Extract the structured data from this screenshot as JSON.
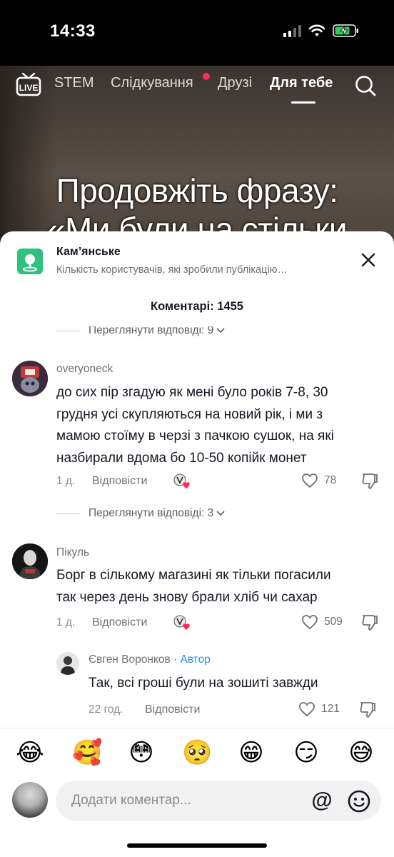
{
  "status_bar": {
    "time": "14:33"
  },
  "nav": {
    "tabs": [
      "STEM",
      "Слідкування",
      "Друзі",
      "Для тебе"
    ],
    "active_tab": "Для тебе",
    "live_label": "LIVE"
  },
  "video": {
    "caption_line1": "Продовжіть фразу:",
    "caption_line2": "«Ми були на стільки"
  },
  "sheet": {
    "location_title": "Кам’янське",
    "location_subtitle": "Кількість користувачів, які зробили публікацію…",
    "comments_count": "Коментарі: 1455",
    "top_replies": "Переглянути відповіді: 9",
    "comments": [
      {
        "username": "overyoneck",
        "text_lines": [
          "до сих пір згадую як мені було років 7-8, 30",
          "грудня усі скупляються на новий рік, і ми з",
          "мамою стоїму в черзі з пачкою сушок, на які",
          "назбирали вдома бо 10-50 копійк монет"
        ],
        "time": "1 д.",
        "reply_label": "Відповісти",
        "likes": "78",
        "replies": "Переглянути відповіді: 3"
      },
      {
        "username": "Пікуль",
        "text_lines": [
          "Борг в сількому магазині як тільки погасили",
          "так через день знову брали хліб чи сахар"
        ],
        "time": "1 д.",
        "reply_label": "Відповісти",
        "likes": "509"
      }
    ],
    "reply": {
      "username": "Євген Воронков",
      "separator": " · ",
      "author_tag": "Автор",
      "text": "Так, всі гроші були на зошиті завжди",
      "time": "22 год.",
      "reply_label": "Відповісти",
      "likes": "121"
    },
    "emojis": [
      "😂",
      "🥰",
      "😳",
      "🥺",
      "😁",
      "😏",
      "😅"
    ],
    "input_placeholder": "Додати коментар...",
    "at_symbol": "@"
  }
}
